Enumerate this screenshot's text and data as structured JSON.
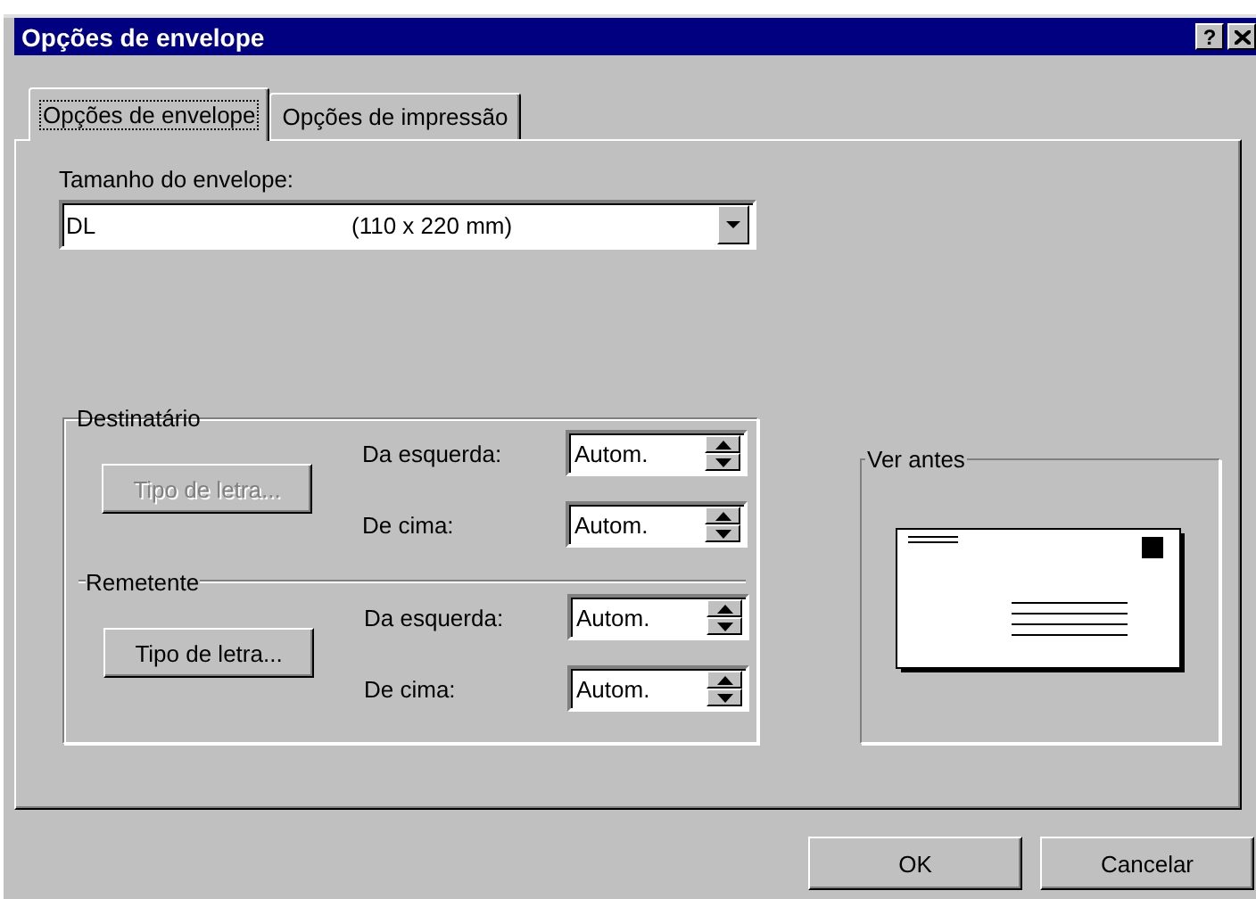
{
  "window": {
    "title": "Opções de envelope",
    "help_button": "?"
  },
  "tabs": [
    {
      "label": "Opções de envelope",
      "selected": true
    },
    {
      "label": "Opções de impressão",
      "selected": false
    }
  ],
  "envelope_size": {
    "label": "Tamanho do envelope:",
    "value": "DL",
    "dimensions": "(110 x 220 mm)"
  },
  "sections": [
    {
      "title": "Destinatário",
      "font_button": {
        "label": "Tipo de letra...",
        "disabled": true
      },
      "fields": [
        {
          "label": "Da esquerda:",
          "value": "Autom."
        },
        {
          "label": "De cima:",
          "value": "Autom."
        }
      ]
    },
    {
      "title": "Remetente",
      "font_button": {
        "label": "Tipo de letra...",
        "disabled": false
      },
      "fields": [
        {
          "label": "Da esquerda:",
          "value": "Autom."
        },
        {
          "label": "De cima:",
          "value": "Autom."
        }
      ]
    }
  ],
  "preview": {
    "title": "Ver antes"
  },
  "buttons": [
    {
      "label": "OK"
    },
    {
      "label": "Cancelar"
    }
  ]
}
